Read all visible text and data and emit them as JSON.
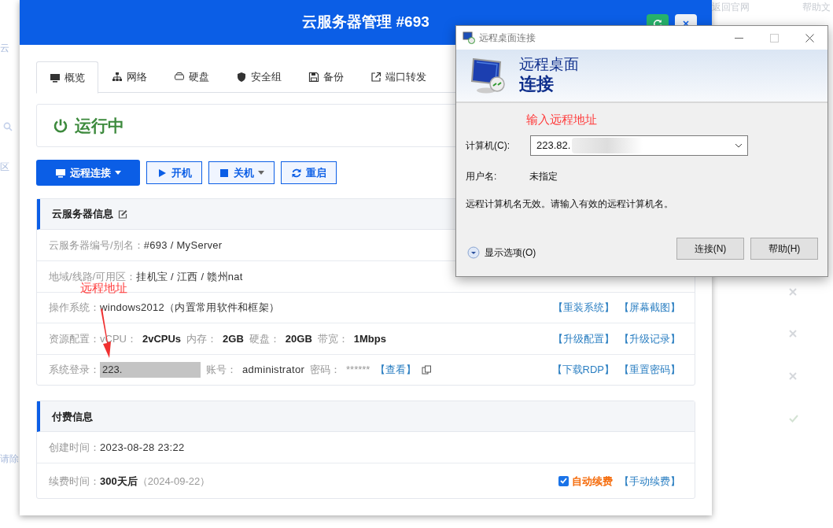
{
  "background": {
    "links": [
      "返回官网",
      "帮助文"
    ],
    "fragments": [
      "云",
      "区",
      "请除"
    ],
    "marks": [
      {
        "kind": "cross"
      },
      {
        "kind": "cross"
      },
      {
        "kind": "cross"
      },
      {
        "kind": "check"
      }
    ]
  },
  "modal": {
    "title": "云服务器管理 #693",
    "tabs": [
      {
        "label": "概览",
        "selected": true
      },
      {
        "label": "网络",
        "selected": false
      },
      {
        "label": "硬盘",
        "selected": false
      },
      {
        "label": "安全组",
        "selected": false
      },
      {
        "label": "备份",
        "selected": false
      },
      {
        "label": "端口转发",
        "selected": false
      }
    ],
    "status": "运行中",
    "actions": [
      {
        "label": "远程连接",
        "kind": "primary",
        "dropdown": true
      },
      {
        "label": "开机",
        "kind": "outline",
        "dropdown": false
      },
      {
        "label": "关机",
        "kind": "outline",
        "dropdown": true
      },
      {
        "label": "重启",
        "kind": "outline",
        "dropdown": false
      }
    ],
    "info": {
      "title": "云服务器信息",
      "rows": [
        {
          "label": "云服务器编号/别名：",
          "segments": [
            {
              "kind": "value",
              "text": "#693 / MyServer"
            }
          ],
          "links": []
        },
        {
          "label": "地域/线路/可用区：",
          "segments": [
            {
              "kind": "value",
              "text": "挂机宝 / 江西 / 赣州nat"
            }
          ],
          "links": []
        },
        {
          "label": "操作系统：",
          "segments": [
            {
              "kind": "value",
              "text": "windows2012（内置常用软件和框架）"
            }
          ],
          "links": [
            "【重装系统】",
            "【屏幕截图】"
          ]
        },
        {
          "label": "资源配置：",
          "segments": [
            {
              "kind": "muted",
              "text": "vCPU："
            },
            {
              "kind": "bold",
              "text": "2vCPUs"
            },
            {
              "kind": "muted",
              "text": "内存："
            },
            {
              "kind": "bold",
              "text": "2GB"
            },
            {
              "kind": "muted",
              "text": "硬盘："
            },
            {
              "kind": "bold",
              "text": "20GB"
            },
            {
              "kind": "muted",
              "text": "带宽："
            },
            {
              "kind": "bold",
              "text": "1Mbps"
            }
          ],
          "links": [
            "【升级配置】",
            "【升级记录】"
          ]
        },
        {
          "label": "系统登录：",
          "segments": [
            {
              "kind": "masked",
              "text": "223."
            },
            {
              "kind": "muted",
              "text": "账号："
            },
            {
              "kind": "value",
              "text": "administrator"
            },
            {
              "kind": "muted",
              "text": "密码："
            },
            {
              "kind": "muted",
              "text": "******"
            },
            {
              "kind": "link",
              "text": "【查看】"
            }
          ],
          "links": [
            "【下载RDP】",
            "【重置密码】"
          ]
        }
      ]
    },
    "billing": {
      "title": "付费信息",
      "rows": [
        {
          "label": "创建时间：",
          "segments": [
            {
              "kind": "value",
              "text": "2023-08-28 23:22"
            }
          ]
        },
        {
          "label": "续费时间：",
          "segments": [
            {
              "kind": "bold",
              "text": "300天后"
            },
            {
              "kind": "muted",
              "text": "（2024-09-22）"
            }
          ],
          "auto_renew": {
            "label": "自动续费",
            "checked": true
          },
          "link": "【手动续费】"
        }
      ]
    }
  },
  "annotation": {
    "text": "远程地址"
  },
  "dialog": {
    "title": "远程桌面连接",
    "banner_line1": "远程桌面",
    "banner_line2": "连接",
    "hint": "输入远程地址",
    "computer_label": "计算机(C):",
    "computer_value": "223.82.",
    "user_label": "用户名:",
    "user_value": "未指定",
    "message": "远程计算机名无效。请输入有效的远程计算机名。",
    "options": "显示选项(O)",
    "buttons": [
      "连接(N)",
      "帮助(H)"
    ]
  }
}
